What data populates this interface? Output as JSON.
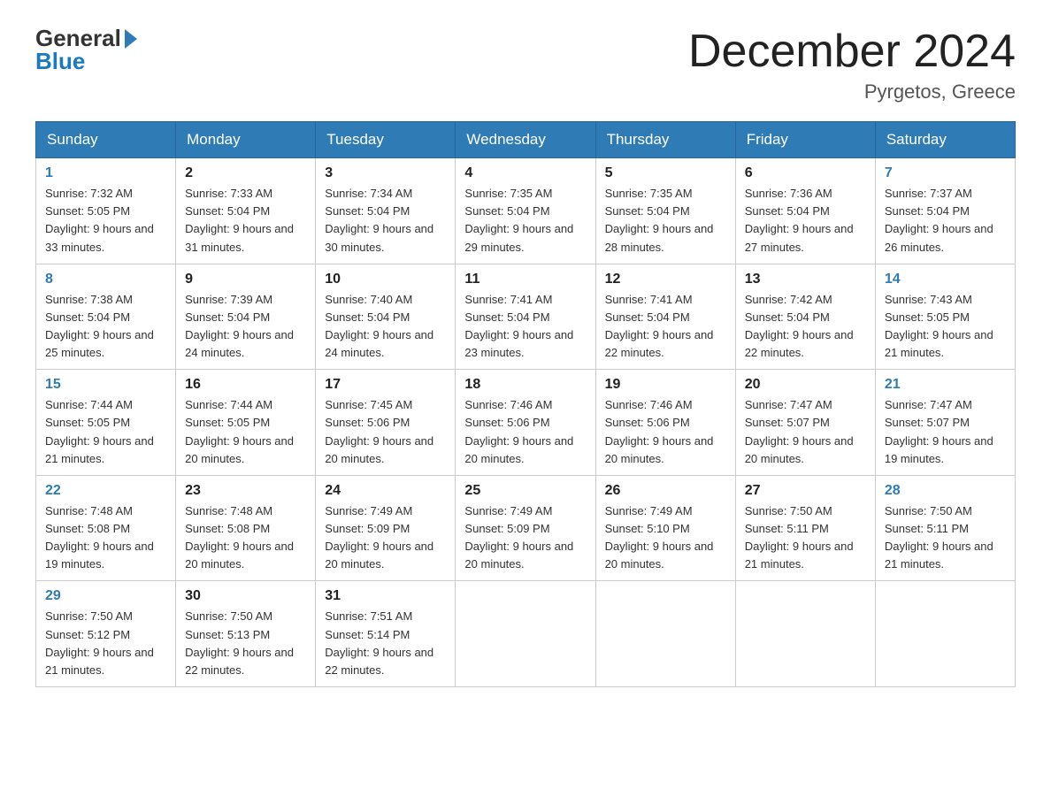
{
  "header": {
    "logo_general": "General",
    "logo_blue": "Blue",
    "month_title": "December 2024",
    "location": "Pyrgetos, Greece"
  },
  "days_of_week": [
    "Sunday",
    "Monday",
    "Tuesday",
    "Wednesday",
    "Thursday",
    "Friday",
    "Saturday"
  ],
  "weeks": [
    [
      {
        "day": "1",
        "sunrise": "7:32 AM",
        "sunset": "5:05 PM",
        "daylight": "9 hours and 33 minutes."
      },
      {
        "day": "2",
        "sunrise": "7:33 AM",
        "sunset": "5:04 PM",
        "daylight": "9 hours and 31 minutes."
      },
      {
        "day": "3",
        "sunrise": "7:34 AM",
        "sunset": "5:04 PM",
        "daylight": "9 hours and 30 minutes."
      },
      {
        "day": "4",
        "sunrise": "7:35 AM",
        "sunset": "5:04 PM",
        "daylight": "9 hours and 29 minutes."
      },
      {
        "day": "5",
        "sunrise": "7:35 AM",
        "sunset": "5:04 PM",
        "daylight": "9 hours and 28 minutes."
      },
      {
        "day": "6",
        "sunrise": "7:36 AM",
        "sunset": "5:04 PM",
        "daylight": "9 hours and 27 minutes."
      },
      {
        "day": "7",
        "sunrise": "7:37 AM",
        "sunset": "5:04 PM",
        "daylight": "9 hours and 26 minutes."
      }
    ],
    [
      {
        "day": "8",
        "sunrise": "7:38 AM",
        "sunset": "5:04 PM",
        "daylight": "9 hours and 25 minutes."
      },
      {
        "day": "9",
        "sunrise": "7:39 AM",
        "sunset": "5:04 PM",
        "daylight": "9 hours and 24 minutes."
      },
      {
        "day": "10",
        "sunrise": "7:40 AM",
        "sunset": "5:04 PM",
        "daylight": "9 hours and 24 minutes."
      },
      {
        "day": "11",
        "sunrise": "7:41 AM",
        "sunset": "5:04 PM",
        "daylight": "9 hours and 23 minutes."
      },
      {
        "day": "12",
        "sunrise": "7:41 AM",
        "sunset": "5:04 PM",
        "daylight": "9 hours and 22 minutes."
      },
      {
        "day": "13",
        "sunrise": "7:42 AM",
        "sunset": "5:04 PM",
        "daylight": "9 hours and 22 minutes."
      },
      {
        "day": "14",
        "sunrise": "7:43 AM",
        "sunset": "5:05 PM",
        "daylight": "9 hours and 21 minutes."
      }
    ],
    [
      {
        "day": "15",
        "sunrise": "7:44 AM",
        "sunset": "5:05 PM",
        "daylight": "9 hours and 21 minutes."
      },
      {
        "day": "16",
        "sunrise": "7:44 AM",
        "sunset": "5:05 PM",
        "daylight": "9 hours and 20 minutes."
      },
      {
        "day": "17",
        "sunrise": "7:45 AM",
        "sunset": "5:06 PM",
        "daylight": "9 hours and 20 minutes."
      },
      {
        "day": "18",
        "sunrise": "7:46 AM",
        "sunset": "5:06 PM",
        "daylight": "9 hours and 20 minutes."
      },
      {
        "day": "19",
        "sunrise": "7:46 AM",
        "sunset": "5:06 PM",
        "daylight": "9 hours and 20 minutes."
      },
      {
        "day": "20",
        "sunrise": "7:47 AM",
        "sunset": "5:07 PM",
        "daylight": "9 hours and 20 minutes."
      },
      {
        "day": "21",
        "sunrise": "7:47 AM",
        "sunset": "5:07 PM",
        "daylight": "9 hours and 19 minutes."
      }
    ],
    [
      {
        "day": "22",
        "sunrise": "7:48 AM",
        "sunset": "5:08 PM",
        "daylight": "9 hours and 19 minutes."
      },
      {
        "day": "23",
        "sunrise": "7:48 AM",
        "sunset": "5:08 PM",
        "daylight": "9 hours and 20 minutes."
      },
      {
        "day": "24",
        "sunrise": "7:49 AM",
        "sunset": "5:09 PM",
        "daylight": "9 hours and 20 minutes."
      },
      {
        "day": "25",
        "sunrise": "7:49 AM",
        "sunset": "5:09 PM",
        "daylight": "9 hours and 20 minutes."
      },
      {
        "day": "26",
        "sunrise": "7:49 AM",
        "sunset": "5:10 PM",
        "daylight": "9 hours and 20 minutes."
      },
      {
        "day": "27",
        "sunrise": "7:50 AM",
        "sunset": "5:11 PM",
        "daylight": "9 hours and 21 minutes."
      },
      {
        "day": "28",
        "sunrise": "7:50 AM",
        "sunset": "5:11 PM",
        "daylight": "9 hours and 21 minutes."
      }
    ],
    [
      {
        "day": "29",
        "sunrise": "7:50 AM",
        "sunset": "5:12 PM",
        "daylight": "9 hours and 21 minutes."
      },
      {
        "day": "30",
        "sunrise": "7:50 AM",
        "sunset": "5:13 PM",
        "daylight": "9 hours and 22 minutes."
      },
      {
        "day": "31",
        "sunrise": "7:51 AM",
        "sunset": "5:14 PM",
        "daylight": "9 hours and 22 minutes."
      },
      null,
      null,
      null,
      null
    ]
  ]
}
